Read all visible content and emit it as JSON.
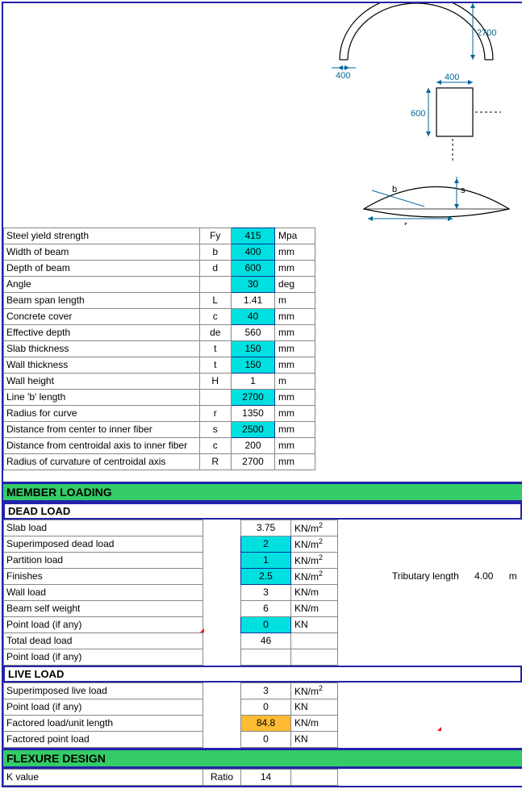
{
  "props": {
    "rows": [
      {
        "label": "Steel yield strength",
        "sym": "Fy",
        "val": "415",
        "unit": "Mpa",
        "cyan": true,
        "cut": true
      },
      {
        "label": "Width of beam",
        "sym": "b",
        "val": "400",
        "unit": "mm",
        "cyan": true
      },
      {
        "label": "Depth of beam",
        "sym": "d",
        "val": "600",
        "unit": "mm",
        "cyan": true
      },
      {
        "label": "Angle",
        "sym": "",
        "val": "30",
        "unit": "deg",
        "cyan": true
      },
      {
        "label": "Beam span length",
        "sym": "L",
        "val": "1.41",
        "unit": "m",
        "cyan": false
      },
      {
        "label": "Concrete cover",
        "sym": "c",
        "val": "40",
        "unit": "mm",
        "cyan": true
      },
      {
        "label": "Effective depth",
        "sym": "de",
        "val": "560",
        "unit": "mm",
        "cyan": false
      },
      {
        "label": "Slab thickness",
        "sym": "t",
        "val": "150",
        "unit": "mm",
        "cyan": true
      },
      {
        "label": "Wall thickness",
        "sym": "t",
        "val": "150",
        "unit": "mm",
        "cyan": true
      },
      {
        "label": "Wall height",
        "sym": "H",
        "val": "1",
        "unit": "m",
        "cyan": false
      },
      {
        "label": "Line 'b' length",
        "sym": "",
        "val": "2700",
        "unit": "mm",
        "cyan": true
      },
      {
        "label": "Radius for curve",
        "sym": "r",
        "val": "1350",
        "unit": "mm",
        "cyan": false
      },
      {
        "label": "Distance from center to inner fiber",
        "sym": "s",
        "val": "2500",
        "unit": "mm",
        "cyan": true
      },
      {
        "label": "Distance from centroidal axis to inner fiber",
        "sym": "c",
        "val": "200",
        "unit": "mm",
        "cyan": false
      },
      {
        "label": "Radius of curvature of centroidal axis",
        "sym": "R",
        "val": "2700",
        "unit": "mm",
        "cyan": false
      }
    ]
  },
  "sections": {
    "member_loading": "MEMBER LOADING",
    "dead_load": "DEAD LOAD",
    "live_load": "LIVE LOAD",
    "flexure": "FLEXURE DESIGN"
  },
  "dead": {
    "rows": [
      {
        "label": "Slab load",
        "val": "3.75",
        "unit": "KN/m²",
        "cyan": false
      },
      {
        "label": "Superimposed dead load",
        "val": "2",
        "unit": "KN/m²",
        "cyan": true
      },
      {
        "label": "Partition load",
        "val": "1",
        "unit": "KN/m²",
        "cyan": true
      },
      {
        "label": "Finishes",
        "val": "2.5",
        "unit": "KN/m²",
        "cyan": true,
        "extra": "tributary"
      },
      {
        "label": "Wall load",
        "val": "3",
        "unit": "KN/m",
        "cyan": false
      },
      {
        "label": "Beam self weight",
        "val": "6",
        "unit": "KN/m",
        "cyan": false
      },
      {
        "label": "Point load (if any)",
        "val": "0",
        "unit": "KN",
        "cyan": true,
        "mark": true
      },
      {
        "label": "Total dead load",
        "val": "46",
        "unit": "",
        "cyan": false
      },
      {
        "label": "Point load (if any)",
        "val": "",
        "unit": "",
        "cyan": false
      }
    ],
    "tributary_label": "Tributary length",
    "tributary_val": "4.00",
    "tributary_unit": "m"
  },
  "live": {
    "rows": [
      {
        "label": "Superimposed live load",
        "val": "3",
        "unit": "KN/m²"
      },
      {
        "label": "Point load (if any)",
        "val": "0",
        "unit": "KN"
      },
      {
        "label": "Factored load/unit length",
        "val": "84.8",
        "unit": "KN/m",
        "orange": true,
        "mark": true
      },
      {
        "label": "Factored point load",
        "val": "0",
        "unit": "KN"
      }
    ]
  },
  "flexure": {
    "label": "K value",
    "sym": "Ratio",
    "val": "14"
  },
  "diagram": {
    "d1_2700": "2700",
    "d1_400": "400",
    "d2_400": "400",
    "d2_600": "600",
    "d3_b": "b",
    "d3_s": "s",
    "d3_r": "r"
  }
}
